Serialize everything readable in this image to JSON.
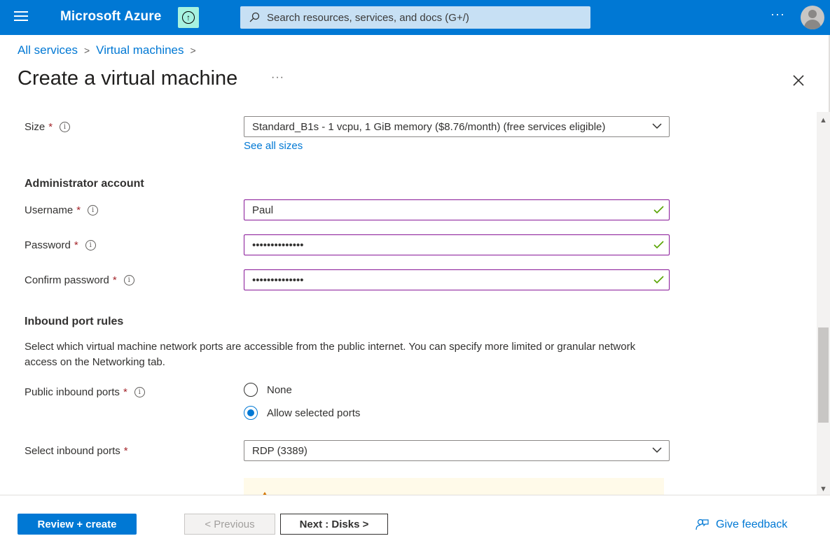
{
  "topbar": {
    "brand": "Microsoft Azure",
    "search_placeholder": "Search resources, services, and docs (G+/)",
    "more": "···",
    "upgrade_icon_glyph": "↑"
  },
  "breadcrumb": {
    "items": [
      "All services",
      "Virtual machines"
    ],
    "separator": ">"
  },
  "page": {
    "title": "Create a virtual machine",
    "more": "···"
  },
  "form": {
    "size": {
      "label": "Size",
      "required_mark": "*",
      "value": "Standard_B1s - 1 vcpu, 1 GiB memory ($8.76/month)  (free services eligible)",
      "see_all_link": "See all sizes"
    },
    "admin_heading": "Administrator account",
    "username": {
      "label": "Username",
      "required_mark": "*",
      "value": "Paul"
    },
    "password": {
      "label": "Password",
      "required_mark": "*",
      "value": "••••••••••••••"
    },
    "confirm_password": {
      "label": "Confirm password",
      "required_mark": "*",
      "value": "••••••••••••••"
    },
    "inbound_heading": "Inbound port rules",
    "inbound_description": "Select which virtual machine network ports are accessible from the public internet. You can specify more limited or granular network access on the Networking tab.",
    "public_ports": {
      "label": "Public inbound ports",
      "required_mark": "*",
      "options": [
        "None",
        "Allow selected ports"
      ],
      "selected": "Allow selected ports"
    },
    "select_ports": {
      "label": "Select inbound ports",
      "required_mark": "*",
      "value": "RDP (3389)"
    }
  },
  "footer": {
    "review_create": "Review + create",
    "previous": "< Previous",
    "next": "Next : Disks >",
    "feedback": "Give feedback"
  },
  "colors": {
    "accent": "#0078d4",
    "valid_border": "#881798",
    "check": "#57a300",
    "required": "#a4262c",
    "upgrade_bg": "#a6f2e0"
  }
}
